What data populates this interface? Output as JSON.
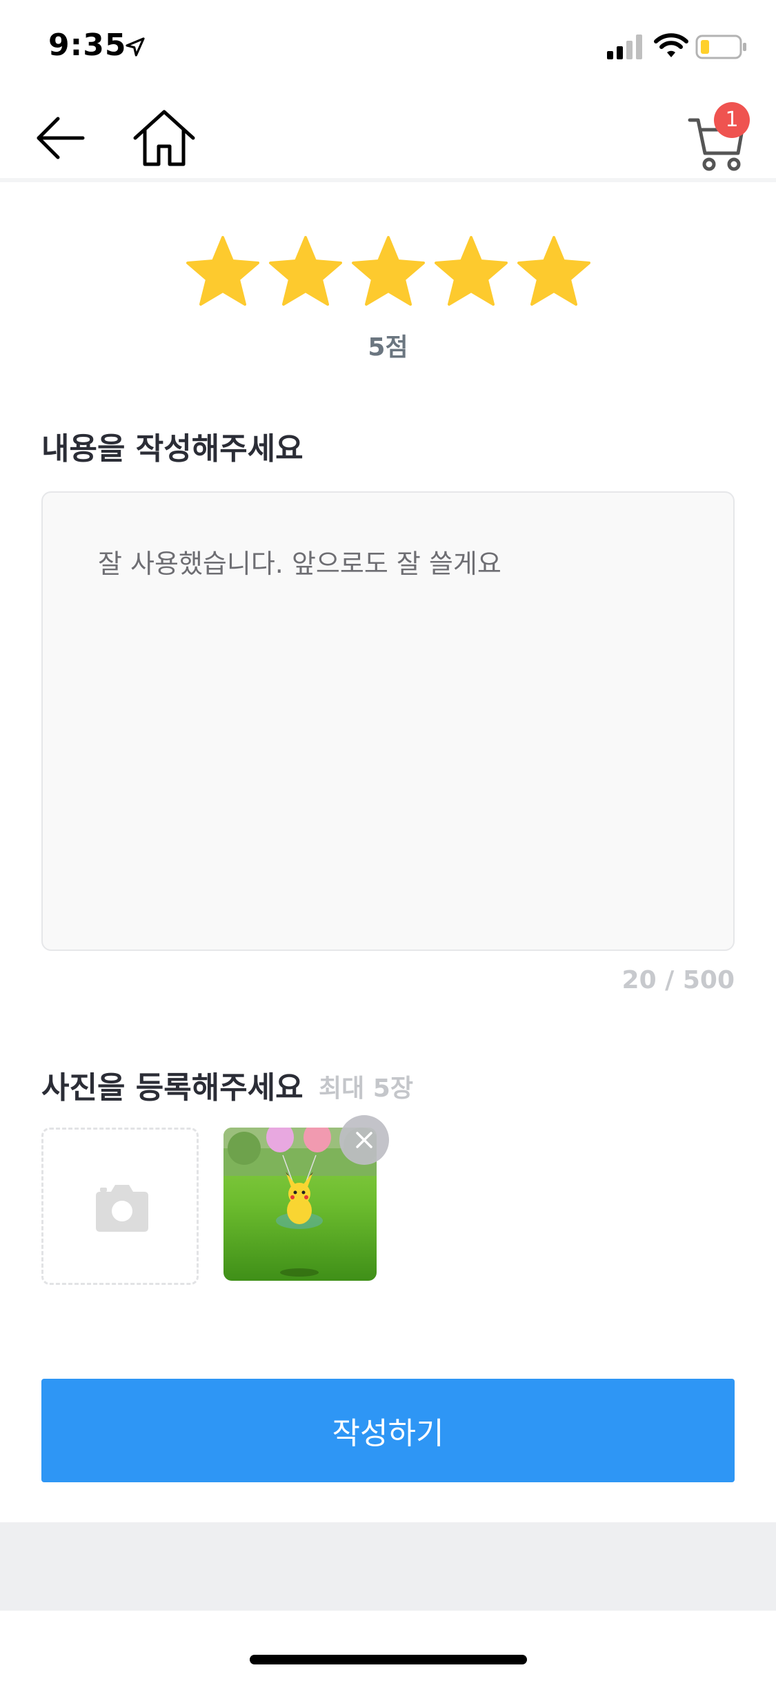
{
  "status_bar": {
    "time": "9:35",
    "icons": [
      "location-arrow-icon",
      "signal-icon",
      "wifi-icon",
      "battery-icon"
    ]
  },
  "nav": {
    "back_icon": "arrow-left-icon",
    "home_icon": "home-icon",
    "cart_icon": "cart-icon",
    "cart_badge": "1"
  },
  "rating": {
    "value": 5,
    "max": 5,
    "label": "5점",
    "star_color": "#fdca2e"
  },
  "content": {
    "heading": "내용을 작성해주세요",
    "value": "잘 사용했습니다. 앞으로도 잘 쓸게요",
    "counter": "20 / 500"
  },
  "photos": {
    "heading": "사진을 등록해주세요",
    "limit": "최대 5장",
    "add_icon": "camera-icon",
    "remove_icon": "close-icon"
  },
  "submit": {
    "label": "작성하기",
    "color": "#2e96f5"
  }
}
